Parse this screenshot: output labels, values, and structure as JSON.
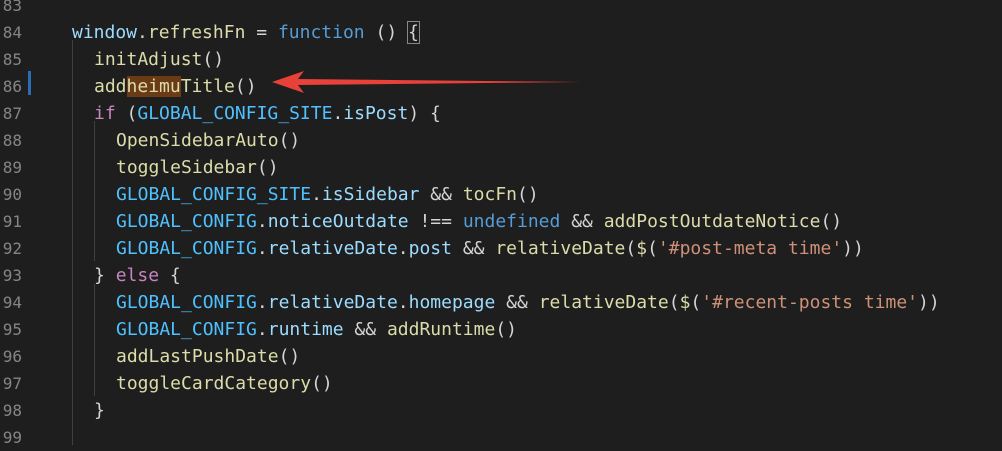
{
  "line_numbers": [
    "83",
    "84",
    "85",
    "86",
    "87",
    "88",
    "89",
    "90",
    "91",
    "92",
    "93",
    "94",
    "95",
    "96",
    "97",
    "98",
    "99"
  ],
  "highlight_word": "heimu",
  "lines": [
    {
      "indent": 0,
      "tokens": []
    },
    {
      "indent": 0,
      "tokens": [
        {
          "t": "window",
          "c": "var"
        },
        {
          "t": ".",
          "c": "pun"
        },
        {
          "t": "refreshFn",
          "c": "fn"
        },
        {
          "t": " = ",
          "c": "op"
        },
        {
          "t": "function",
          "c": "kw"
        },
        {
          "t": " () ",
          "c": "pun"
        },
        {
          "t": "{",
          "c": "pun brk"
        }
      ]
    },
    {
      "indent": 1,
      "tokens": [
        {
          "t": "initAdjust",
          "c": "fn"
        },
        {
          "t": "()",
          "c": "pun"
        }
      ]
    },
    {
      "indent": 1,
      "tokens": [
        {
          "t": "add",
          "c": "fn"
        },
        {
          "t": "heimu",
          "c": "fn hl"
        },
        {
          "t": "Title",
          "c": "fn"
        },
        {
          "t": "()",
          "c": "pun"
        }
      ]
    },
    {
      "indent": 1,
      "tokens": [
        {
          "t": "if",
          "c": "ctrl"
        },
        {
          "t": " (",
          "c": "pun"
        },
        {
          "t": "GLOBAL_CONFIG_SITE",
          "c": "cst"
        },
        {
          "t": ".",
          "c": "pun"
        },
        {
          "t": "isPost",
          "c": "var"
        },
        {
          "t": ") {",
          "c": "pun"
        }
      ]
    },
    {
      "indent": 2,
      "tokens": [
        {
          "t": "OpenSidebarAuto",
          "c": "fn"
        },
        {
          "t": "()",
          "c": "pun"
        }
      ]
    },
    {
      "indent": 2,
      "tokens": [
        {
          "t": "toggleSidebar",
          "c": "fn"
        },
        {
          "t": "()",
          "c": "pun"
        }
      ]
    },
    {
      "indent": 2,
      "tokens": [
        {
          "t": "GLOBAL_CONFIG_SITE",
          "c": "cst"
        },
        {
          "t": ".",
          "c": "pun"
        },
        {
          "t": "isSidebar",
          "c": "var"
        },
        {
          "t": " && ",
          "c": "op"
        },
        {
          "t": "tocFn",
          "c": "fn"
        },
        {
          "t": "()",
          "c": "pun"
        }
      ]
    },
    {
      "indent": 2,
      "tokens": [
        {
          "t": "GLOBAL_CONFIG",
          "c": "cst"
        },
        {
          "t": ".",
          "c": "pun"
        },
        {
          "t": "noticeOutdate",
          "c": "var"
        },
        {
          "t": " !== ",
          "c": "op"
        },
        {
          "t": "undefined",
          "c": "kw"
        },
        {
          "t": " && ",
          "c": "op"
        },
        {
          "t": "addPostOutdateNotice",
          "c": "fn"
        },
        {
          "t": "()",
          "c": "pun"
        }
      ]
    },
    {
      "indent": 2,
      "tokens": [
        {
          "t": "GLOBAL_CONFIG",
          "c": "cst"
        },
        {
          "t": ".",
          "c": "pun"
        },
        {
          "t": "relativeDate",
          "c": "var"
        },
        {
          "t": ".",
          "c": "pun"
        },
        {
          "t": "post",
          "c": "var"
        },
        {
          "t": " && ",
          "c": "op"
        },
        {
          "t": "relativeDate",
          "c": "fn"
        },
        {
          "t": "(",
          "c": "pun"
        },
        {
          "t": "$",
          "c": "fn"
        },
        {
          "t": "(",
          "c": "pun"
        },
        {
          "t": "'#post-meta time'",
          "c": "str"
        },
        {
          "t": "))",
          "c": "pun"
        }
      ]
    },
    {
      "indent": 1,
      "tokens": [
        {
          "t": "} ",
          "c": "pun"
        },
        {
          "t": "else",
          "c": "ctrl"
        },
        {
          "t": " {",
          "c": "pun"
        }
      ]
    },
    {
      "indent": 2,
      "tokens": [
        {
          "t": "GLOBAL_CONFIG",
          "c": "cst"
        },
        {
          "t": ".",
          "c": "pun"
        },
        {
          "t": "relativeDate",
          "c": "var"
        },
        {
          "t": ".",
          "c": "pun"
        },
        {
          "t": "homepage",
          "c": "var"
        },
        {
          "t": " && ",
          "c": "op"
        },
        {
          "t": "relativeDate",
          "c": "fn"
        },
        {
          "t": "(",
          "c": "pun"
        },
        {
          "t": "$",
          "c": "fn"
        },
        {
          "t": "(",
          "c": "pun"
        },
        {
          "t": "'#recent-posts time'",
          "c": "str"
        },
        {
          "t": "))",
          "c": "pun"
        }
      ]
    },
    {
      "indent": 2,
      "tokens": [
        {
          "t": "GLOBAL_CONFIG",
          "c": "cst"
        },
        {
          "t": ".",
          "c": "pun"
        },
        {
          "t": "runtime",
          "c": "var"
        },
        {
          "t": " && ",
          "c": "op"
        },
        {
          "t": "addRuntime",
          "c": "fn"
        },
        {
          "t": "()",
          "c": "pun"
        }
      ]
    },
    {
      "indent": 2,
      "tokens": [
        {
          "t": "addLastPushDate",
          "c": "fn"
        },
        {
          "t": "()",
          "c": "pun"
        }
      ]
    },
    {
      "indent": 2,
      "tokens": [
        {
          "t": "toggleCardCategory",
          "c": "fn"
        },
        {
          "t": "()",
          "c": "pun"
        }
      ]
    },
    {
      "indent": 1,
      "tokens": [
        {
          "t": "}",
          "c": "pun"
        }
      ]
    },
    {
      "indent": 0,
      "tokens": []
    }
  ],
  "colors": {
    "background": "#1e1e1e",
    "line_number": "#858585",
    "modified_bar": "#2a6db4",
    "arrow": "#e8413a",
    "find_highlight": "#6b3b16"
  }
}
